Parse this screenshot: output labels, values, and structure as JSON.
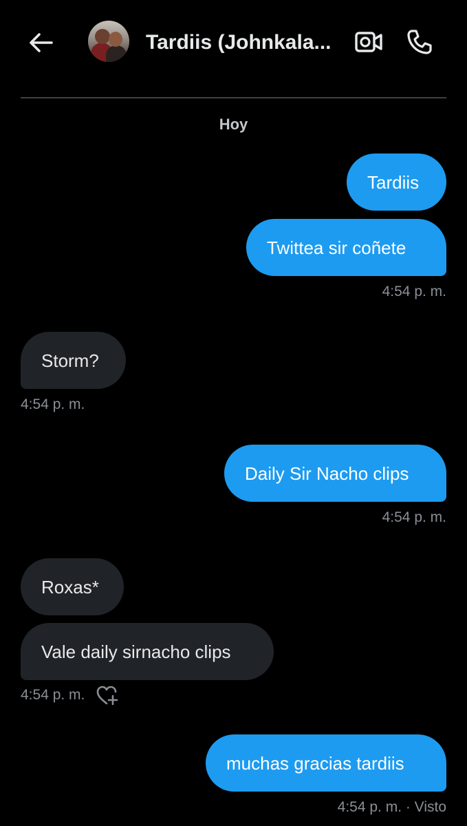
{
  "header": {
    "title": "Tardiis (Johnkala...",
    "back_icon": "arrow-left-icon",
    "video_icon": "video-camera-icon",
    "call_icon": "phone-icon"
  },
  "date_separator": "Hoy",
  "colors": {
    "outgoing_bubble": "#1d9bf0",
    "incoming_bubble": "#202327",
    "background": "#000000",
    "timestamp": "#8b8f94"
  },
  "messages": [
    {
      "direction": "outgoing",
      "text": "Tardiis"
    },
    {
      "direction": "outgoing",
      "text": "Twittea sir coñete",
      "timestamp": "4:54 p. m."
    },
    {
      "direction": "incoming",
      "text": "Storm?",
      "timestamp": "4:54 p. m."
    },
    {
      "direction": "outgoing",
      "text": "Daily Sir Nacho clips",
      "timestamp": "4:54 p. m."
    },
    {
      "direction": "incoming",
      "text": "Roxas*"
    },
    {
      "direction": "incoming",
      "text": "Vale daily sirnacho clips",
      "timestamp": "4:54 p. m.",
      "reaction_icon": "heart-plus-icon"
    },
    {
      "direction": "outgoing",
      "text": "muchas gracias tardiis",
      "timestamp": "4:54 p. m. · Visto"
    }
  ]
}
